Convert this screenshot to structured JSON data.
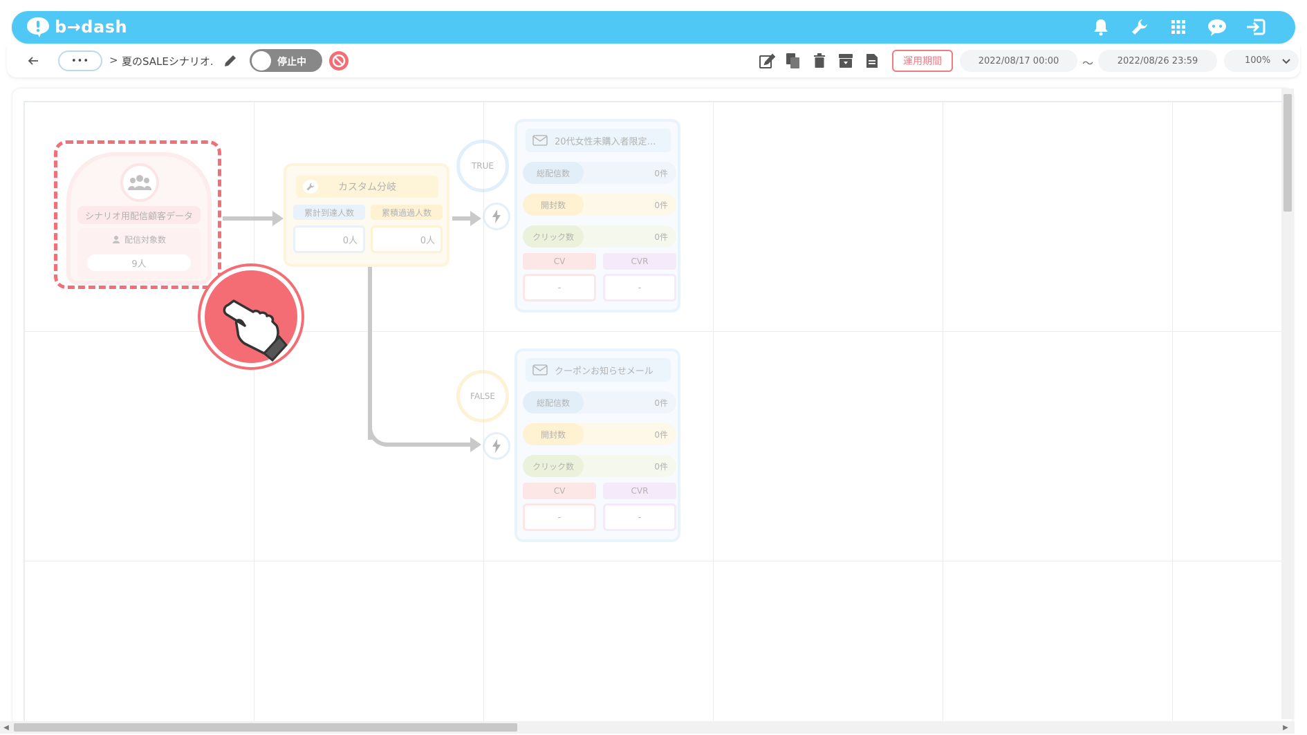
{
  "app": {
    "logo_text": "b→dash"
  },
  "header": {
    "icons": [
      "bell-icon",
      "wrench-icon",
      "apps-grid-icon",
      "chat-robot-icon",
      "logout-icon"
    ]
  },
  "toolbar": {
    "more_label": "•••",
    "breadcrumb_sep": ">",
    "scenario_name": "夏のSALEシナリオ.",
    "status_toggle_label": "停止中",
    "period_button": "運用期間",
    "date_start": "2022/08/17 00:00",
    "date_tilde": "〜",
    "date_end": "2022/08/26 23:59",
    "zoom": "100%"
  },
  "colors": {
    "header": "#4fc8f6",
    "accent_red": "#f07a82",
    "toggle_off": "#888888"
  },
  "nodes": {
    "segment": {
      "title": "シナリオ用配信顧客データ",
      "sub_label": "配信対象数",
      "value": "9人"
    },
    "branch": {
      "title": "カスタム分岐",
      "col1_label": "累計到達人数",
      "col1_value": "0人",
      "col2_label": "累積過過人数",
      "col2_value": "0人"
    },
    "true_label": "TRUE",
    "false_label": "FALSE",
    "mail1": {
      "title": "20代女性未購入者限定…",
      "total_label": "総配信数",
      "total_value": "0件",
      "open_label": "開封数",
      "open_value": "0件",
      "click_label": "クリック数",
      "click_value": "0件",
      "cv_label": "CV",
      "cv_value": "-",
      "cvr_label": "CVR",
      "cvr_value": "-"
    },
    "mail2": {
      "title": "クーポンお知らせメール",
      "total_label": "総配信数",
      "total_value": "0件",
      "open_label": "開封数",
      "open_value": "0件",
      "click_label": "クリック数",
      "click_value": "0件",
      "cv_label": "CV",
      "cv_value": "-",
      "cvr_label": "CVR",
      "cvr_value": "-"
    }
  }
}
